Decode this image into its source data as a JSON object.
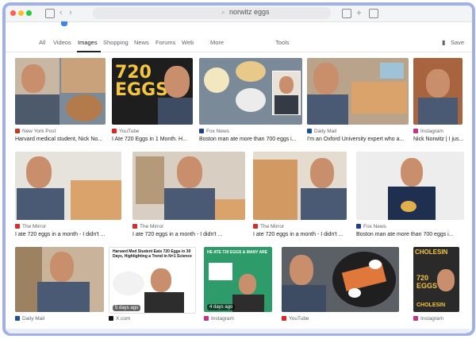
{
  "browser": {
    "address": "norwitz eggs"
  },
  "tabs": {
    "all": "All",
    "videos": "Videos",
    "images": "Images",
    "shopping": "Shopping",
    "news": "News",
    "forums": "Forums",
    "web": "Web",
    "separator": "⋮",
    "more": "More",
    "tools": "Tools",
    "save": "Save"
  },
  "results": {
    "row1": [
      {
        "source": "New York Post",
        "caption": "Harvard medical student, Nick No...",
        "fav": "#c0392b"
      },
      {
        "source": "YouTube",
        "caption": "I Ate 720 Eggs in 1 Month. H...",
        "fav": "#e02424"
      },
      {
        "source": "Fox News",
        "caption": "Boston man ate more than 700 eggs i...",
        "fav": "#1f3f8a"
      },
      {
        "source": "Daily Mail",
        "caption": "I'm an Oxford University expert who a...",
        "fav": "#1d4f91"
      },
      {
        "source": "Instagram",
        "caption": "Nick Norwitz | I jus...",
        "fav": "#c13584"
      }
    ],
    "row2": [
      {
        "source": "The Mirror",
        "caption": "I ate 720 eggs in a month - I didn't ...",
        "fav": "#d32f2f"
      },
      {
        "source": "The Mirror",
        "caption": "I ate 720 eggs in a month - I didn't ...",
        "fav": "#d32f2f"
      },
      {
        "source": "The Mirror",
        "caption": "I ate 720 eggs in a month - I didn't ...",
        "fav": "#d32f2f"
      },
      {
        "source": "Fox News",
        "caption": "Boston man ate more than 700 eggs i...",
        "fav": "#1f3f8a"
      }
    ],
    "row3": [
      {
        "source": "Daily Mail",
        "fav": "#1d4f91"
      },
      {
        "source": "X.com",
        "fav": "#111111"
      },
      {
        "source": "Instagram",
        "fav": "#c13584"
      },
      {
        "source": "YouTube",
        "fav": "#e02424"
      },
      {
        "source": "Instagram",
        "fav": "#c13584"
      }
    ]
  },
  "thumbnails": {
    "eggs_title": "720 EGGS",
    "x_headline": "Harvard Med Student Eats 720 Eggs in 30 Days, Highlighting a Trend in N=1 Science",
    "x_badge": "5 days ago",
    "ig_headline": "HE ATE 720 EGGS & MANY ARE",
    "ig_badge": "4 days ago",
    "chol_top": "CHOLESIN",
    "chol_mid": "720 EGGS",
    "chol_bottom": "CHOLESIN"
  },
  "colors": {
    "accent_border": "#9fb1e8",
    "egg": "#d9a36b",
    "hoodie": "#4a5a75"
  }
}
